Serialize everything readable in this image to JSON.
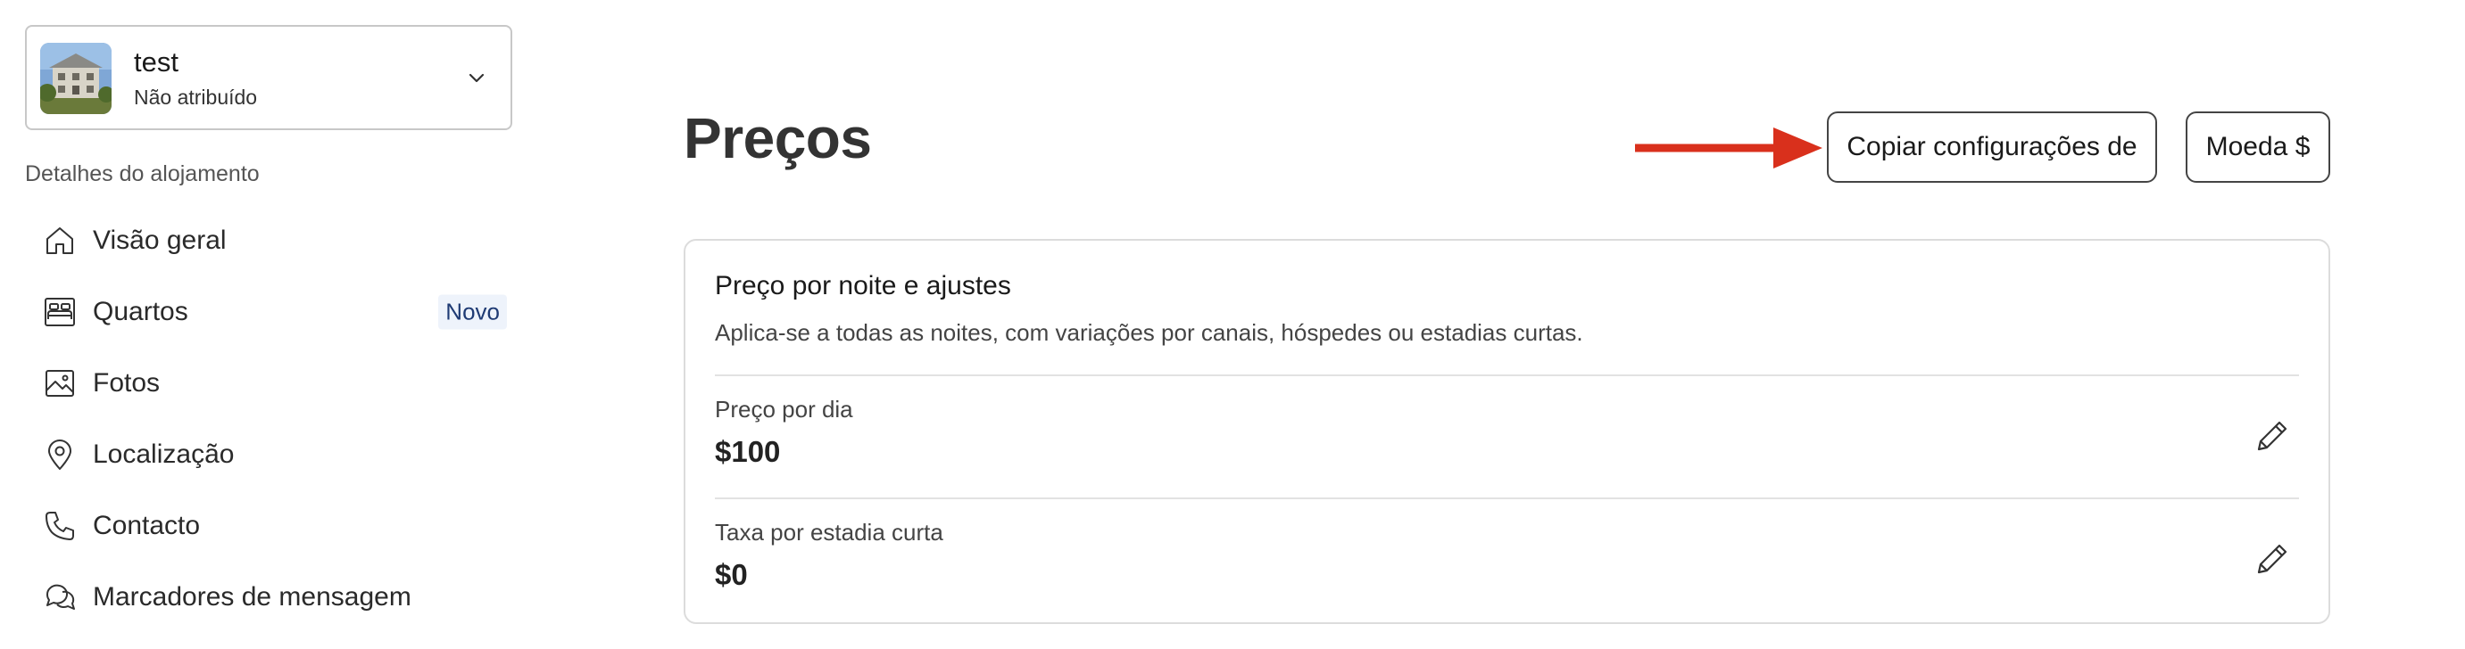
{
  "property_selector": {
    "name": "test",
    "status": "Não atribuído",
    "thumbnail_icon": "building-photo",
    "chevron_icon": "chevron-down-icon"
  },
  "sidebar": {
    "section_label": "Detalhes do alojamento",
    "items": [
      {
        "label": "Visão geral",
        "icon": "home-icon"
      },
      {
        "label": "Quartos",
        "icon": "bed-icon",
        "badge": "Novo"
      },
      {
        "label": "Fotos",
        "icon": "image-icon"
      },
      {
        "label": "Localização",
        "icon": "map-pin-icon"
      },
      {
        "label": "Contacto",
        "icon": "phone-icon"
      },
      {
        "label": "Marcadores de mensagem",
        "icon": "chat-bubbles-icon"
      }
    ]
  },
  "main": {
    "title": "Preços",
    "copy_button_label": "Copiar configurações de",
    "currency_button_label": "Moeda $",
    "annotation_arrow_color": "#d9301c",
    "panel": {
      "title": "Preço por noite e ajustes",
      "description": "Aplica-se a todas as noites, com variações por canais, hóspedes ou estadias curtas.",
      "rows": [
        {
          "label": "Preço por dia",
          "value": "$100",
          "icon": "pencil-icon"
        },
        {
          "label": "Taxa por estadia curta",
          "value": "$0",
          "icon": "pencil-icon"
        }
      ]
    }
  }
}
